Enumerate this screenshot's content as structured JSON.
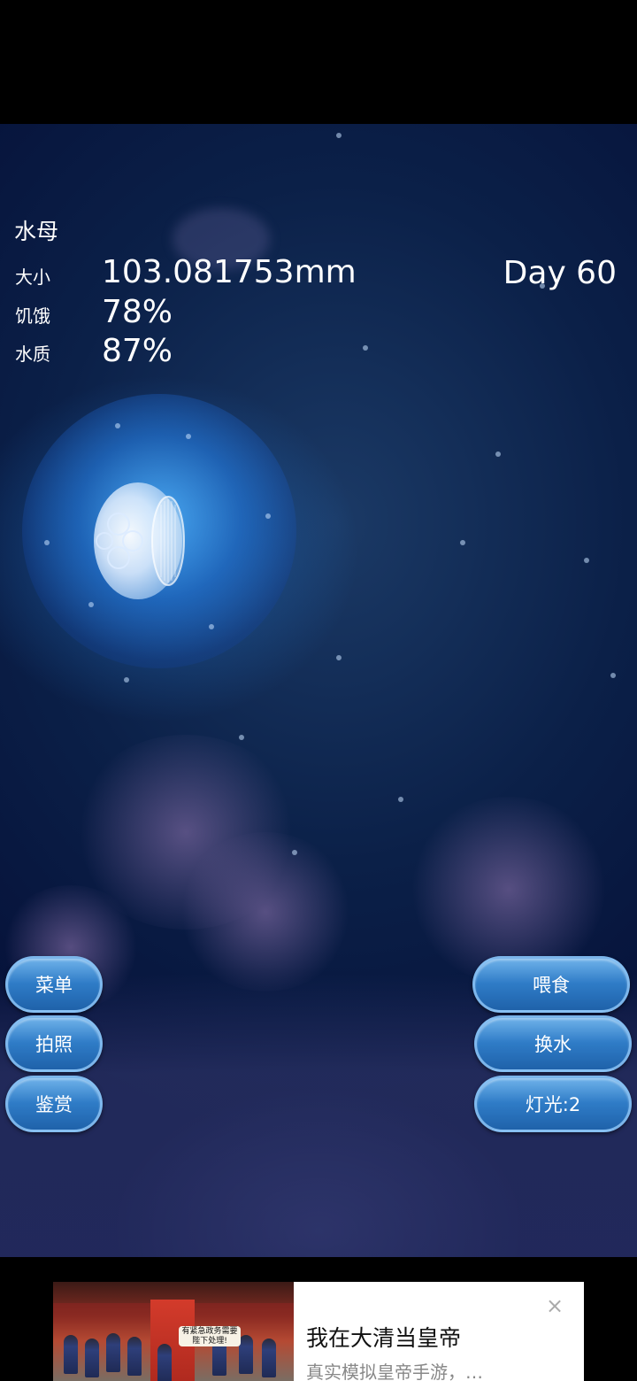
{
  "hud": {
    "title": "水母",
    "size_label": "大小",
    "size_value": "103.081753mm",
    "hunger_label": "饥饿",
    "hunger_value": "78%",
    "water_label": "水质",
    "water_value": "87%",
    "day": "Day 60"
  },
  "buttons": {
    "menu": "菜单",
    "photo": "拍照",
    "appreciate": "鉴赏",
    "feed": "喂食",
    "change_water": "换水",
    "light": "灯光:2"
  },
  "ad": {
    "image_caption": "有紧急政务需要陛下处理!",
    "title": "我在大清当皇帝",
    "subtitle": "真实模拟皇帝手游，…",
    "close": "×"
  },
  "colors": {
    "button_top": "#6fb2ea",
    "button_bottom": "#1f62aa",
    "water_deep": "#06123a",
    "glow": "#3a9cf0"
  }
}
